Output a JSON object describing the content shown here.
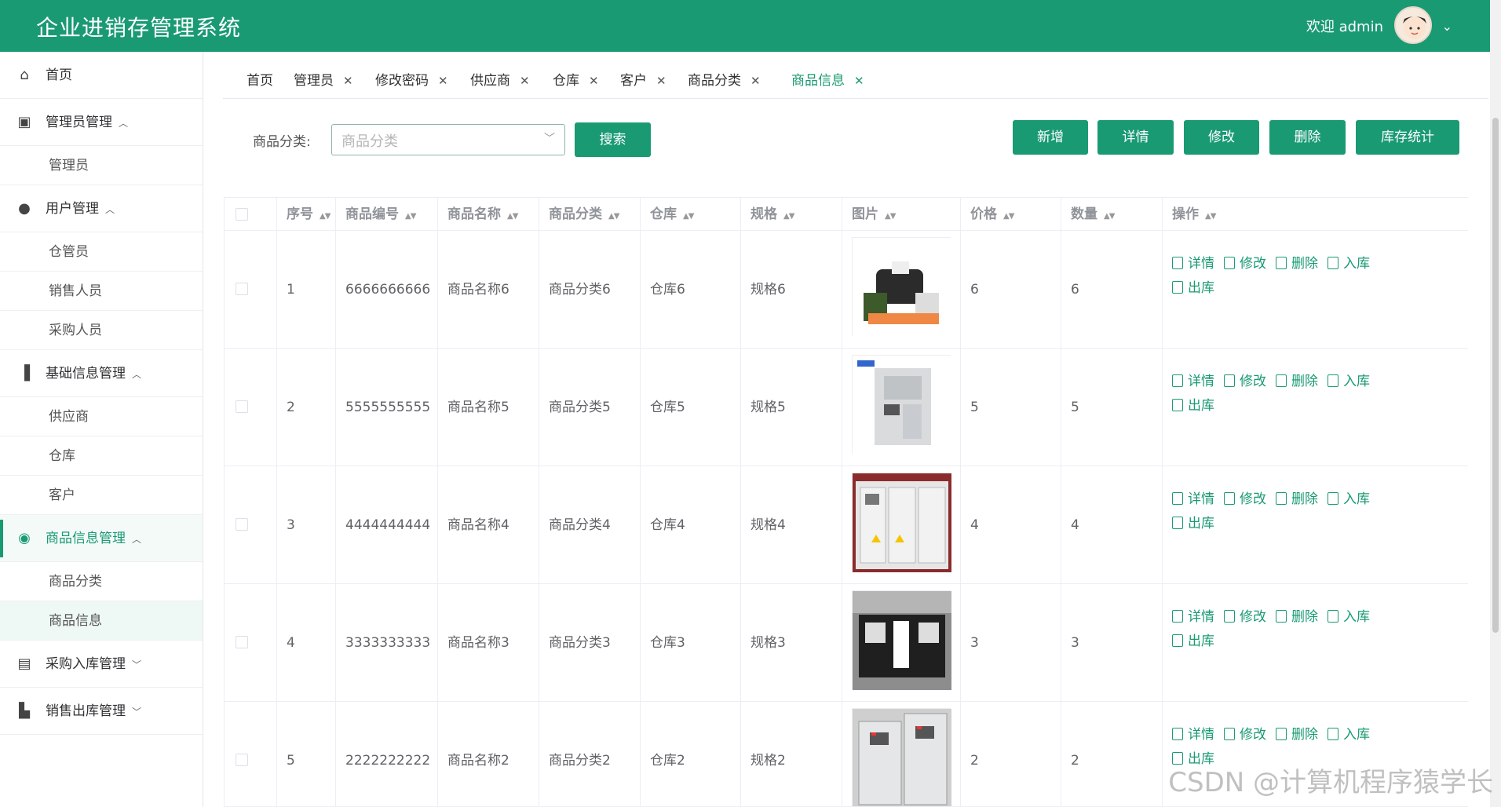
{
  "app": {
    "title": "企业进销存管理系统",
    "welcome": "欢迎 admin"
  },
  "colors": {
    "brand": "#1a9a73"
  },
  "sidebar": {
    "items": [
      {
        "label": "首页",
        "icon": "home-icon"
      },
      {
        "label": "管理员管理",
        "icon": "cpu-icon",
        "expanded": true,
        "children": [
          "管理员"
        ]
      },
      {
        "label": "用户管理",
        "icon": "user-icon",
        "expanded": true,
        "children": [
          "仓管员",
          "销售人员",
          "采购人员"
        ]
      },
      {
        "label": "基础信息管理",
        "icon": "book-icon",
        "expanded": true,
        "children": [
          "供应商",
          "仓库",
          "客户"
        ]
      },
      {
        "label": "商品信息管理",
        "icon": "compass-icon",
        "expanded": true,
        "active": true,
        "children": [
          "商品分类",
          "商品信息"
        ]
      },
      {
        "label": "采购入库管理",
        "icon": "box-icon",
        "expanded": false
      },
      {
        "label": "销售出库管理",
        "icon": "building-icon",
        "expanded": false
      }
    ]
  },
  "tabs": [
    "首页",
    "管理员",
    "修改密码",
    "供应商",
    "仓库",
    "客户",
    "商品分类",
    "商品信息"
  ],
  "filter": {
    "label": "商品分类:",
    "placeholder": "商品分类",
    "search_label": "搜索"
  },
  "actions": {
    "add": "新增",
    "detail": "详情",
    "edit": "修改",
    "delete": "删除",
    "stats": "库存统计"
  },
  "table": {
    "columns": [
      "序号",
      "商品编号",
      "商品名称",
      "商品分类",
      "仓库",
      "规格",
      "图片",
      "价格",
      "数量",
      "操作"
    ],
    "row_ops": [
      "详情",
      "修改",
      "删除",
      "入库",
      "出库"
    ],
    "rows": [
      {
        "idx": "1",
        "code": "6666666666",
        "name": "商品名称6",
        "category": "商品分类6",
        "warehouse": "仓库6",
        "spec": "规格6",
        "price": "6",
        "qty": "6"
      },
      {
        "idx": "2",
        "code": "5555555555",
        "name": "商品名称5",
        "category": "商品分类5",
        "warehouse": "仓库5",
        "spec": "规格5",
        "price": "5",
        "qty": "5"
      },
      {
        "idx": "3",
        "code": "4444444444",
        "name": "商品名称4",
        "category": "商品分类4",
        "warehouse": "仓库4",
        "spec": "规格4",
        "price": "4",
        "qty": "4"
      },
      {
        "idx": "4",
        "code": "3333333333",
        "name": "商品名称3",
        "category": "商品分类3",
        "warehouse": "仓库3",
        "spec": "规格3",
        "price": "3",
        "qty": "3"
      },
      {
        "idx": "5",
        "code": "2222222222",
        "name": "商品名称2",
        "category": "商品分类2",
        "warehouse": "仓库2",
        "spec": "规格2",
        "price": "2",
        "qty": "2"
      }
    ]
  },
  "watermark": "CSDN @计算机程序猿学长"
}
